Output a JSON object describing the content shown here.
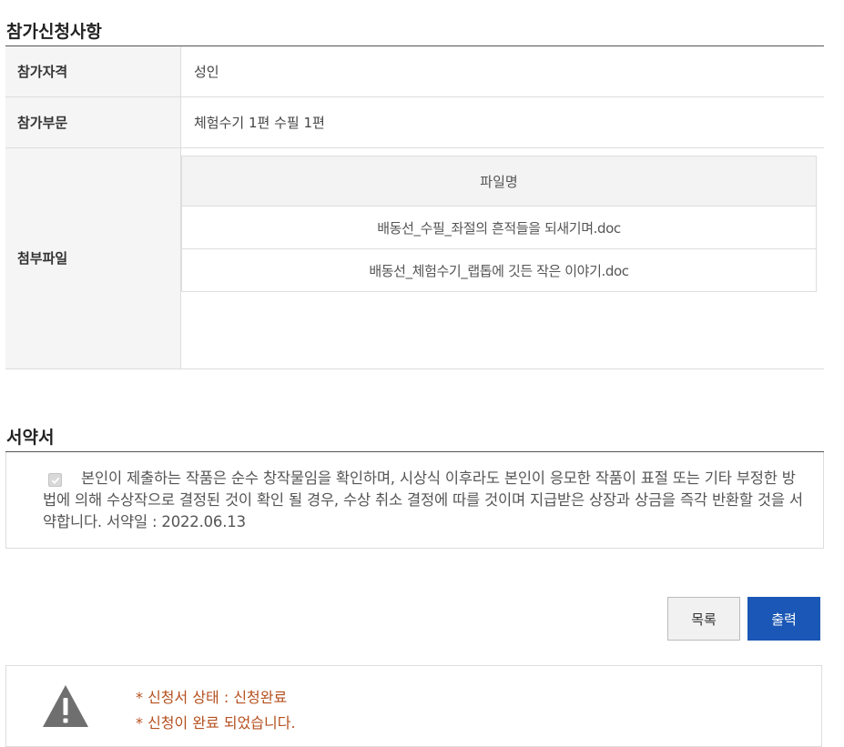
{
  "section1": {
    "title": "참가신청사항",
    "rows": {
      "qualification": {
        "label": "참가자격",
        "value": "성인"
      },
      "category": {
        "label": "참가부문",
        "value": "체험수기 1편 수필 1편"
      },
      "attachments": {
        "label": "첨부파일"
      }
    },
    "files": {
      "header": "파일명",
      "items": [
        "배동선_수필_좌절의 흔적들을 되새기며.doc",
        "배동선_체험수기_랩톱에 깃든 작은 이야기.doc"
      ]
    }
  },
  "section2": {
    "title": "서약서",
    "checked": true,
    "text": "본인이 제출하는 작품은 순수 창작물임을 확인하며, 시상식 이후라도 본인이 응모한 작품이 표절 또는 기타 부정한 방법에 의해 수상작으로 결정된 것이 확인 될 경우, 수상 취소 결정에 따를 것이며 지급받은 상장과 상금을 즉각 반환할 것을 서약합니다. 서약일 : 2022.06.13"
  },
  "buttons": {
    "list": "목록",
    "print": "출력"
  },
  "status": {
    "line1": "* 신청서 상태 : 신청완료",
    "line2": "* 신청이 완료 되었습니다.",
    "icon": "warning-icon"
  },
  "colors": {
    "primary_button": "#1a57b6",
    "status_text": "#b5501f"
  }
}
